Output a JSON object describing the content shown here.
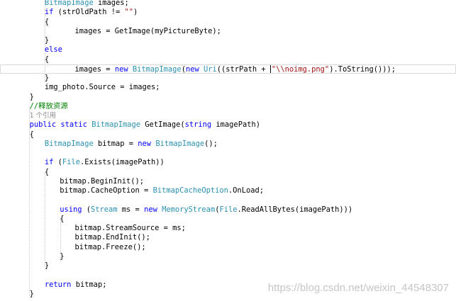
{
  "editor": {
    "colors": {
      "keyword": "#0000ff",
      "type": "#2b91af",
      "string": "#a31515",
      "comment": "#008000",
      "plain": "#000000",
      "codelens": "#8a8a8a"
    },
    "lines": [
      {
        "indent": 3,
        "tokens": [
          {
            "k": "type",
            "t": "BitmapImage"
          },
          {
            "k": "plain",
            "t": " images;"
          }
        ]
      },
      {
        "indent": 3,
        "tokens": [
          {
            "k": "kw",
            "t": "if"
          },
          {
            "k": "plain",
            "t": " (strOldPath != "
          },
          {
            "k": "str",
            "t": "\"\""
          },
          {
            "k": "plain",
            "t": ")"
          }
        ]
      },
      {
        "indent": 3,
        "tokens": [
          {
            "k": "plain",
            "t": "{"
          }
        ]
      },
      {
        "indent": 5,
        "tokens": [
          {
            "k": "plain",
            "t": "images = GetImage(myPictureByte);"
          }
        ]
      },
      {
        "indent": 3,
        "tokens": [
          {
            "k": "plain",
            "t": "}"
          }
        ]
      },
      {
        "indent": 3,
        "tokens": [
          {
            "k": "kw",
            "t": "else"
          }
        ]
      },
      {
        "indent": 3,
        "tokens": [
          {
            "k": "plain",
            "t": "{"
          }
        ]
      },
      {
        "indent": 5,
        "current": true,
        "tokens": [
          {
            "k": "plain",
            "t": "images = "
          },
          {
            "k": "kw",
            "t": "new"
          },
          {
            "k": "plain",
            "t": " "
          },
          {
            "k": "type",
            "t": "BitmapImage"
          },
          {
            "k": "plain",
            "t": "("
          },
          {
            "k": "kw",
            "t": "new"
          },
          {
            "k": "plain",
            "t": " "
          },
          {
            "k": "type",
            "t": "Uri"
          },
          {
            "k": "plain",
            "t": "((strPath + "
          },
          {
            "k": "caret",
            "t": ""
          },
          {
            "k": "str",
            "t": "\"\\\\noimg.png\""
          },
          {
            "k": "plain",
            "t": ").ToString()));"
          }
        ]
      },
      {
        "indent": 3,
        "tokens": [
          {
            "k": "plain",
            "t": "}"
          }
        ]
      },
      {
        "indent": 3,
        "tokens": [
          {
            "k": "plain",
            "t": "img_photo.Source = images;"
          }
        ]
      },
      {
        "indent": 2,
        "tokens": [
          {
            "k": "plain",
            "t": "}"
          }
        ]
      },
      {
        "indent": 2,
        "tokens": [
          {
            "k": "cmt",
            "t": "//释放资源"
          }
        ]
      },
      {
        "indent": 2,
        "lens": true,
        "tokens": [
          {
            "k": "lens",
            "t": "1 个引用"
          }
        ]
      },
      {
        "indent": 2,
        "tokens": [
          {
            "k": "kw",
            "t": "public"
          },
          {
            "k": "plain",
            "t": " "
          },
          {
            "k": "kw",
            "t": "static"
          },
          {
            "k": "plain",
            "t": " "
          },
          {
            "k": "type",
            "t": "BitmapImage"
          },
          {
            "k": "plain",
            "t": " GetImage("
          },
          {
            "k": "kw",
            "t": "string"
          },
          {
            "k": "plain",
            "t": " imagePath)"
          }
        ]
      },
      {
        "indent": 2,
        "tokens": [
          {
            "k": "plain",
            "t": "{"
          }
        ]
      },
      {
        "indent": 3,
        "tokens": [
          {
            "k": "type",
            "t": "BitmapImage"
          },
          {
            "k": "plain",
            "t": " bitmap = "
          },
          {
            "k": "kw",
            "t": "new"
          },
          {
            "k": "plain",
            "t": " "
          },
          {
            "k": "type",
            "t": "BitmapImage"
          },
          {
            "k": "plain",
            "t": "();"
          }
        ]
      },
      {
        "indent": 0,
        "tokens": []
      },
      {
        "indent": 3,
        "tokens": [
          {
            "k": "kw",
            "t": "if"
          },
          {
            "k": "plain",
            "t": " ("
          },
          {
            "k": "type",
            "t": "File"
          },
          {
            "k": "plain",
            "t": ".Exists(imagePath))"
          }
        ]
      },
      {
        "indent": 3,
        "tokens": [
          {
            "k": "plain",
            "t": "{"
          }
        ]
      },
      {
        "indent": 4,
        "tokens": [
          {
            "k": "plain",
            "t": "bitmap.BeginInit();"
          }
        ]
      },
      {
        "indent": 4,
        "tokens": [
          {
            "k": "plain",
            "t": "bitmap.CacheOption = "
          },
          {
            "k": "type",
            "t": "BitmapCacheOption"
          },
          {
            "k": "plain",
            "t": ".OnLoad;"
          }
        ]
      },
      {
        "indent": 0,
        "tokens": []
      },
      {
        "indent": 4,
        "tokens": [
          {
            "k": "kw",
            "t": "using"
          },
          {
            "k": "plain",
            "t": " ("
          },
          {
            "k": "type",
            "t": "Stream"
          },
          {
            "k": "plain",
            "t": " ms = "
          },
          {
            "k": "kw",
            "t": "new"
          },
          {
            "k": "plain",
            "t": " "
          },
          {
            "k": "type",
            "t": "MemoryStream"
          },
          {
            "k": "plain",
            "t": "("
          },
          {
            "k": "type",
            "t": "File"
          },
          {
            "k": "plain",
            "t": ".ReadAllBytes(imagePath)))"
          }
        ]
      },
      {
        "indent": 4,
        "tokens": [
          {
            "k": "plain",
            "t": "{"
          }
        ]
      },
      {
        "indent": 5,
        "tokens": [
          {
            "k": "plain",
            "t": "bitmap.StreamSource = ms;"
          }
        ]
      },
      {
        "indent": 5,
        "tokens": [
          {
            "k": "plain",
            "t": "bitmap.EndInit();"
          }
        ]
      },
      {
        "indent": 5,
        "tokens": [
          {
            "k": "plain",
            "t": "bitmap.Freeze();"
          }
        ]
      },
      {
        "indent": 4,
        "tokens": [
          {
            "k": "plain",
            "t": "}"
          }
        ]
      },
      {
        "indent": 3,
        "tokens": [
          {
            "k": "plain",
            "t": "}"
          }
        ]
      },
      {
        "indent": 0,
        "tokens": []
      },
      {
        "indent": 3,
        "tokens": [
          {
            "k": "kw",
            "t": "return"
          },
          {
            "k": "plain",
            "t": " bitmap;"
          }
        ]
      },
      {
        "indent": 2,
        "tokens": [
          {
            "k": "plain",
            "t": "}"
          }
        ]
      }
    ]
  },
  "watermark": {
    "text": "https://blog.csdn.net/weixin_44548307"
  }
}
